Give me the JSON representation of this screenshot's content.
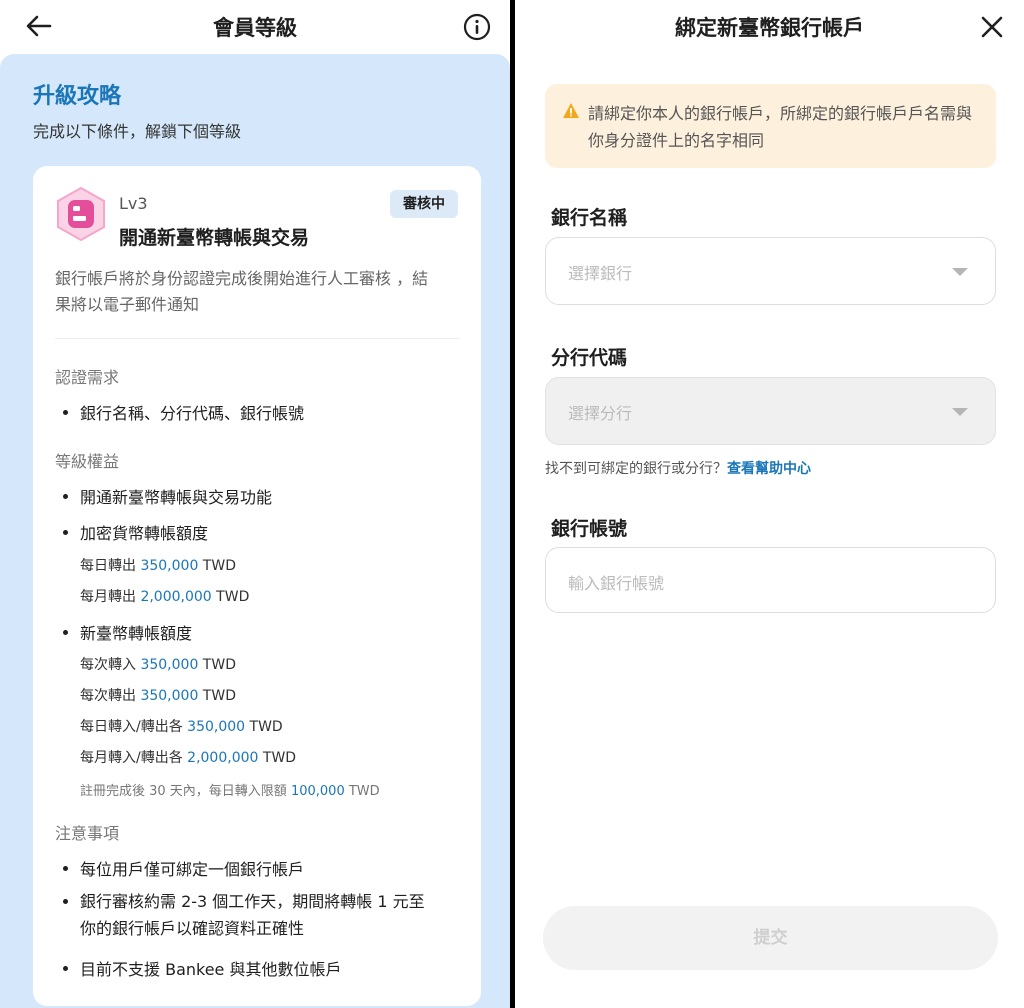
{
  "left_screen": {
    "header": {
      "title": "會員等級"
    },
    "guide": {
      "title": "升級攻略",
      "subtitle": "完成以下條件，解鎖下個等級"
    },
    "card": {
      "level": "Lv3",
      "title": "開通新臺幣轉帳與交易",
      "status": "審核中",
      "description": "銀行帳戶將於身份認證完成後開始進行人工審核 ，結果將以電子郵件通知",
      "requirements_heading": "認證需求",
      "requirements": [
        "銀行名稱、分行代碼、銀行帳號"
      ],
      "benefits_heading": "等級權益",
      "benefit_1": "開通新臺幣轉帳與交易功能",
      "benefit_2": "加密貨幣轉帳額度",
      "crypto_limits": [
        {
          "label": "每日轉出 ",
          "value": "350,000",
          "unit": " TWD"
        },
        {
          "label": "每月轉出 ",
          "value": "2,000,000",
          "unit": " TWD"
        }
      ],
      "benefit_3": "新臺幣轉帳額度",
      "twd_limits": [
        {
          "label": "每次轉入 ",
          "value": "350,000",
          "unit": " TWD"
        },
        {
          "label": "每次轉出 ",
          "value": "350,000",
          "unit": " TWD"
        },
        {
          "label": "每日轉入/轉出各 ",
          "value": "350,000",
          "unit": " TWD"
        },
        {
          "label": "每月轉入/轉出各 ",
          "value": "2,000,000",
          "unit": " TWD"
        }
      ],
      "new_user_note": {
        "label": "註冊完成後 30 天內，每日轉入限額 ",
        "value": "100,000",
        "unit": " TWD"
      },
      "notes_heading": "注意事項",
      "notes": [
        "每位用戶僅可綁定一個銀行帳戶",
        "銀行審核約需 2-3 個工作天，期間將轉帳 1 元至你的銀行帳戶以確認資料正確性",
        "目前不支援 Bankee 與其他數位帳戶"
      ]
    }
  },
  "right_screen": {
    "title": "綁定新臺幣銀行帳戶",
    "warning": "請綁定你本人的銀行帳戶，所綁定的銀行帳戶戶名需與你身分證件上的名字相同",
    "bank_name": {
      "label": "銀行名稱",
      "placeholder": "選擇銀行"
    },
    "branch_code": {
      "label": "分行代碼",
      "placeholder": "選擇分行"
    },
    "help": {
      "text": "找不到可綁定的銀行或分行？",
      "link": "查看幫助中心"
    },
    "account_number": {
      "label": "銀行帳號",
      "placeholder": "輸入銀行帳號"
    },
    "submit_label": "提交"
  },
  "colors": {
    "accent": "#1b76b8",
    "guide_background": "#d5e8fb",
    "warning_background": "#fdf0dd",
    "warning_icon": "#f0a81c",
    "level_badge": "#e44d9a"
  },
  "icons": [
    "back-arrow-icon",
    "info-icon",
    "level-badge-icon",
    "warning-icon",
    "close-icon",
    "chevron-down-icon"
  ]
}
